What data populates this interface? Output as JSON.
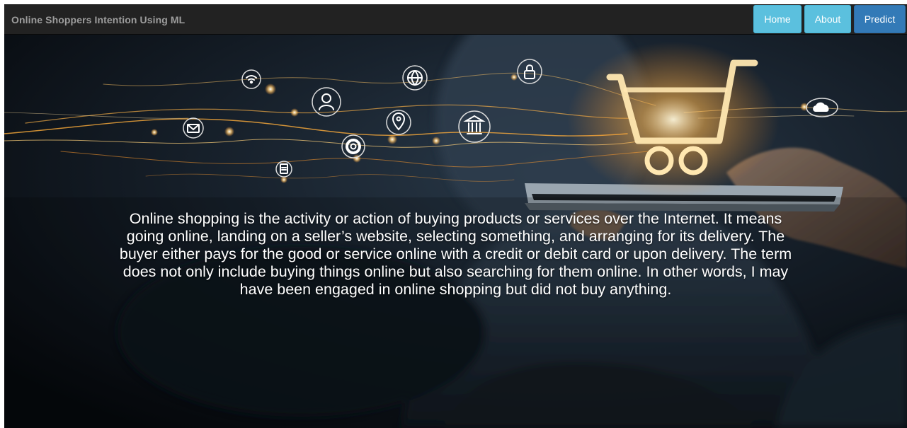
{
  "navbar": {
    "brand": "Online Shoppers Intention Using ML",
    "links": [
      {
        "label": "Home"
      },
      {
        "label": "About"
      },
      {
        "label": "Predict"
      }
    ]
  },
  "hero": {
    "description": "Online shopping is the activity or action of buying products or services over the Internet. It means going online, landing on a seller’s website, selecting something, and arranging for its delivery. The buyer either pays for the good or service online with a credit or debit card or upon delivery. The term does not only include buying things online but also searching for them online. In other words, I may have been engaged in online shopping but did not buy anything.",
    "background_icons": [
      "wifi-icon",
      "globe-icon",
      "lock-icon",
      "user-icon",
      "mail-icon",
      "location-pin-icon",
      "bank-icon",
      "gear-icon",
      "document-icon",
      "cloud-icon",
      "shopping-cart-icon",
      "tablet-icon"
    ]
  },
  "colors": {
    "navbar_bg": "#222222",
    "brand_text": "#9d9d9d",
    "info_button": "#5bc0de",
    "primary_button": "#337ab7",
    "glow": "#ffb347"
  }
}
